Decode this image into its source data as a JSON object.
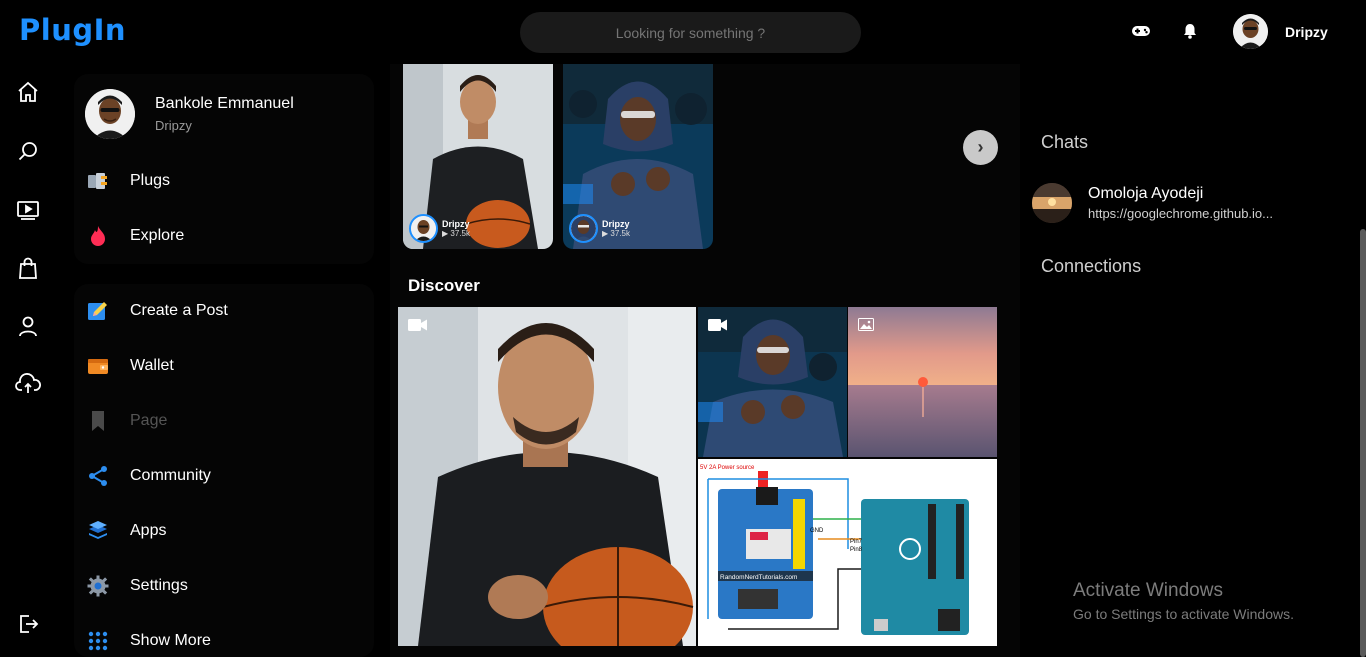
{
  "app": {
    "logo": "PlugIn"
  },
  "search": {
    "placeholder": "Looking for something ?"
  },
  "header": {
    "username": "Dripzy"
  },
  "profile": {
    "name": "Bankole Emmanuel",
    "handle": "Dripzy"
  },
  "sidebar": {
    "top_items": [
      {
        "label": "Plugs",
        "icon": "plugs-icon"
      },
      {
        "label": "Explore",
        "icon": "flame-icon"
      }
    ],
    "items": [
      {
        "label": "Create a Post",
        "icon": "edit-icon"
      },
      {
        "label": "Wallet",
        "icon": "wallet-icon"
      },
      {
        "label": "Page",
        "icon": "bookmark-icon",
        "disabled": true
      },
      {
        "label": "Community",
        "icon": "share-nodes-icon"
      },
      {
        "label": "Apps",
        "icon": "layers-icon"
      },
      {
        "label": "Settings",
        "icon": "gear-icon"
      },
      {
        "label": "Show More",
        "icon": "grid-dots-icon"
      }
    ]
  },
  "stories": [
    {
      "name": "Dripzy",
      "views": "37.5k"
    },
    {
      "name": "Dripzy",
      "views": "37.5k"
    }
  ],
  "discover": {
    "title": "Discover"
  },
  "diagram_texts": {
    "title": "5V 2A Power source",
    "credit": "RandomNerdTutorials.com",
    "gnd": "GND",
    "pin7": "Pin7",
    "pin8": "Pin8"
  },
  "right_panel": {
    "chats_title": "Chats",
    "chat": {
      "name": "Omoloja Ayodeji",
      "message": "https://googlechrome.github.io..."
    },
    "connections_title": "Connections"
  },
  "watermark": {
    "line1": "Activate Windows",
    "line2": "Go to Settings to activate Windows."
  },
  "colors": {
    "accent": "#1e90ff",
    "background": "#000000",
    "card": "#050505"
  }
}
